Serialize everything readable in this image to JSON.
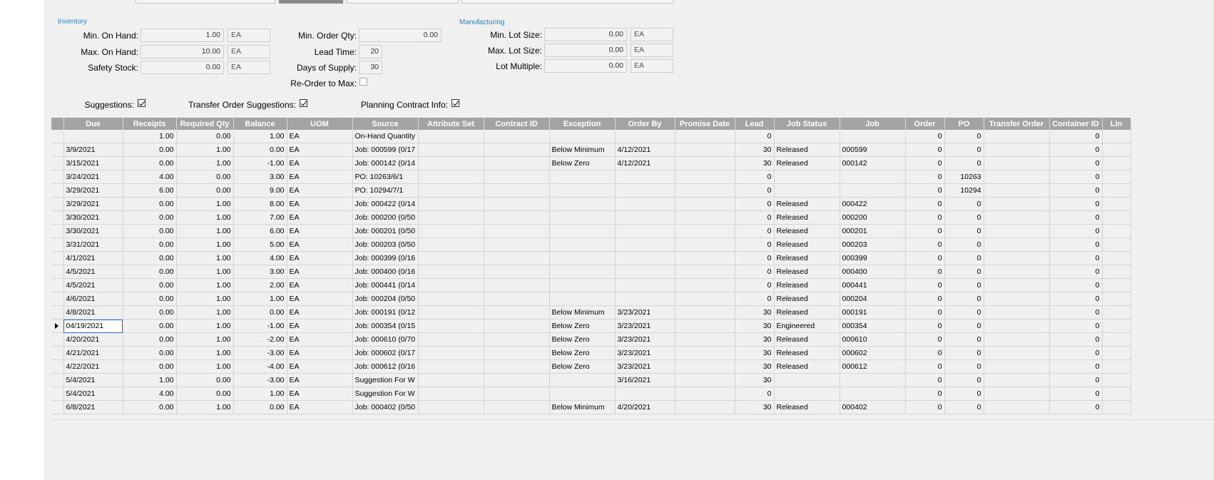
{
  "inventory": {
    "title": "Inventory",
    "min_on_hand": {
      "label": "Min. On Hand:",
      "value": "1.00",
      "uom": "EA"
    },
    "max_on_hand": {
      "label": "Max. On Hand:",
      "value": "10.00",
      "uom": "EA"
    },
    "safety_stock": {
      "label": "Safety Stock:",
      "value": "0.00",
      "uom": "EA"
    },
    "min_order_qty": {
      "label": "Min. Order Qty:",
      "value": "0.00"
    },
    "lead_time": {
      "label": "Lead Time:",
      "value": "20"
    },
    "days_of_supply": {
      "label": "Days of Supply:",
      "value": "30"
    },
    "reorder_to_max": {
      "label": "Re-Order to Max:",
      "checked": false
    }
  },
  "manufacturing": {
    "title": "Manufacturing",
    "min_lot_size": {
      "label": "Min. Lot Size:",
      "value": "0.00",
      "uom": "EA"
    },
    "max_lot_size": {
      "label": "Max. Lot Size:",
      "value": "0.00",
      "uom": "EA"
    },
    "lot_multiple": {
      "label": "Lot Multiple:",
      "value": "0.00",
      "uom": "EA"
    }
  },
  "options": {
    "suggestions": {
      "label": "Suggestions:",
      "checked": true
    },
    "transfer_order_suggestions": {
      "label": "Transfer Order Suggestions:",
      "checked": true
    },
    "planning_contract_info": {
      "label": "Planning Contract Info:",
      "checked": true
    }
  },
  "grid": {
    "columns": [
      "Due",
      "Receipts",
      "Required Qty",
      "Balance",
      "UOM",
      "Source",
      "Attribute Set",
      "Contract ID",
      "Exception",
      "Order By",
      "Promise Date",
      "Lead",
      "Job Status",
      "Job",
      "Order",
      "PO",
      "Transfer Order",
      "Container ID",
      "Lin"
    ],
    "active_row": 14,
    "rows": [
      [
        "",
        "1.00",
        "0.00",
        "1.00",
        "EA",
        "On-Hand Quantity",
        "",
        "",
        "",
        "",
        "",
        "0",
        "",
        "",
        "0",
        "0",
        "",
        "0"
      ],
      [
        "3/9/2021",
        "0.00",
        "1.00",
        "0.00",
        "EA",
        "Job: 000599 (0/17",
        "",
        "",
        "Below Minimum",
        "4/12/2021",
        "",
        "30",
        "Released",
        "000599",
        "0",
        "0",
        "",
        "0"
      ],
      [
        "3/15/2021",
        "0.00",
        "1.00",
        "-1.00",
        "EA",
        "Job: 000142 (0/14",
        "",
        "",
        "Below Zero",
        "4/12/2021",
        "",
        "30",
        "Released",
        "000142",
        "0",
        "0",
        "",
        "0"
      ],
      [
        "3/24/2021",
        "4.00",
        "0.00",
        "3.00",
        "EA",
        "PO: 10263/6/1",
        "",
        "",
        "",
        "",
        "",
        "0",
        "",
        "",
        "0",
        "10263",
        "",
        "0"
      ],
      [
        "3/29/2021",
        "6.00",
        "0.00",
        "9.00",
        "EA",
        "PO: 10294/7/1",
        "",
        "",
        "",
        "",
        "",
        "0",
        "",
        "",
        "0",
        "10294",
        "",
        "0"
      ],
      [
        "3/29/2021",
        "0.00",
        "1.00",
        "8.00",
        "EA",
        "Job: 000422 (0/14",
        "",
        "",
        "",
        "",
        "",
        "0",
        "Released",
        "000422",
        "0",
        "0",
        "",
        "0"
      ],
      [
        "3/30/2021",
        "0.00",
        "1.00",
        "7.00",
        "EA",
        "Job: 000200 (0/50",
        "",
        "",
        "",
        "",
        "",
        "0",
        "Released",
        "000200",
        "0",
        "0",
        "",
        "0"
      ],
      [
        "3/30/2021",
        "0.00",
        "1.00",
        "6.00",
        "EA",
        "Job: 000201 (0/50",
        "",
        "",
        "",
        "",
        "",
        "0",
        "Released",
        "000201",
        "0",
        "0",
        "",
        "0"
      ],
      [
        "3/31/2021",
        "0.00",
        "1.00",
        "5.00",
        "EA",
        "Job: 000203 (0/50",
        "",
        "",
        "",
        "",
        "",
        "0",
        "Released",
        "000203",
        "0",
        "0",
        "",
        "0"
      ],
      [
        "4/1/2021",
        "0.00",
        "1.00",
        "4.00",
        "EA",
        "Job: 000399 (0/16",
        "",
        "",
        "",
        "",
        "",
        "0",
        "Released",
        "000399",
        "0",
        "0",
        "",
        "0"
      ],
      [
        "4/5/2021",
        "0.00",
        "1.00",
        "3.00",
        "EA",
        "Job: 000400 (0/16",
        "",
        "",
        "",
        "",
        "",
        "0",
        "Released",
        "000400",
        "0",
        "0",
        "",
        "0"
      ],
      [
        "4/5/2021",
        "0.00",
        "1.00",
        "2.00",
        "EA",
        "Job: 000441 (0/14",
        "",
        "",
        "",
        "",
        "",
        "0",
        "Released",
        "000441",
        "0",
        "0",
        "",
        "0"
      ],
      [
        "4/6/2021",
        "0.00",
        "1.00",
        "1.00",
        "EA",
        "Job: 000204 (0/50",
        "",
        "",
        "",
        "",
        "",
        "0",
        "Released",
        "000204",
        "0",
        "0",
        "",
        "0"
      ],
      [
        "4/8/2021",
        "0.00",
        "1.00",
        "0.00",
        "EA",
        "Job: 000191 (0/12",
        "",
        "",
        "Below Minimum",
        "3/23/2021",
        "",
        "30",
        "Released",
        "000191",
        "0",
        "0",
        "",
        "0"
      ],
      [
        "04/19/2021",
        "0.00",
        "1.00",
        "-1.00",
        "EA",
        "Job: 000354 (0/15",
        "",
        "",
        "Below Zero",
        "3/23/2021",
        "",
        "30",
        "Engineered",
        "000354",
        "0",
        "0",
        "",
        "0"
      ],
      [
        "4/20/2021",
        "0.00",
        "1.00",
        "-2.00",
        "EA",
        "Job: 000610 (0/70",
        "",
        "",
        "Below Zero",
        "3/23/2021",
        "",
        "30",
        "Released",
        "000610",
        "0",
        "0",
        "",
        "0"
      ],
      [
        "4/21/2021",
        "0.00",
        "1.00",
        "-3.00",
        "EA",
        "Job: 000602 (0/17",
        "",
        "",
        "Below Zero",
        "3/23/2021",
        "",
        "30",
        "Released",
        "000602",
        "0",
        "0",
        "",
        "0"
      ],
      [
        "4/22/2021",
        "0.00",
        "1.00",
        "-4.00",
        "EA",
        "Job: 000612 (0/16",
        "",
        "",
        "Below Zero",
        "3/23/2021",
        "",
        "30",
        "Released",
        "000612",
        "0",
        "0",
        "",
        "0"
      ],
      [
        "5/4/2021",
        "1.00",
        "0.00",
        "-3.00",
        "EA",
        "Suggestion For W",
        "",
        "",
        "",
        "3/16/2021",
        "",
        "30",
        "",
        "",
        "0",
        "0",
        "",
        "0"
      ],
      [
        "5/4/2021",
        "4.00",
        "0.00",
        "1.00",
        "EA",
        "Suggestion For W",
        "",
        "",
        "",
        "",
        "",
        "0",
        "",
        "",
        "0",
        "0",
        "",
        "0"
      ],
      [
        "6/8/2021",
        "0.00",
        "1.00",
        "0.00",
        "EA",
        "Job: 000402 (0/50",
        "",
        "",
        "Below Minimum",
        "4/20/2021",
        "",
        "30",
        "Released",
        "000402",
        "0",
        "0",
        "",
        "0"
      ]
    ]
  }
}
